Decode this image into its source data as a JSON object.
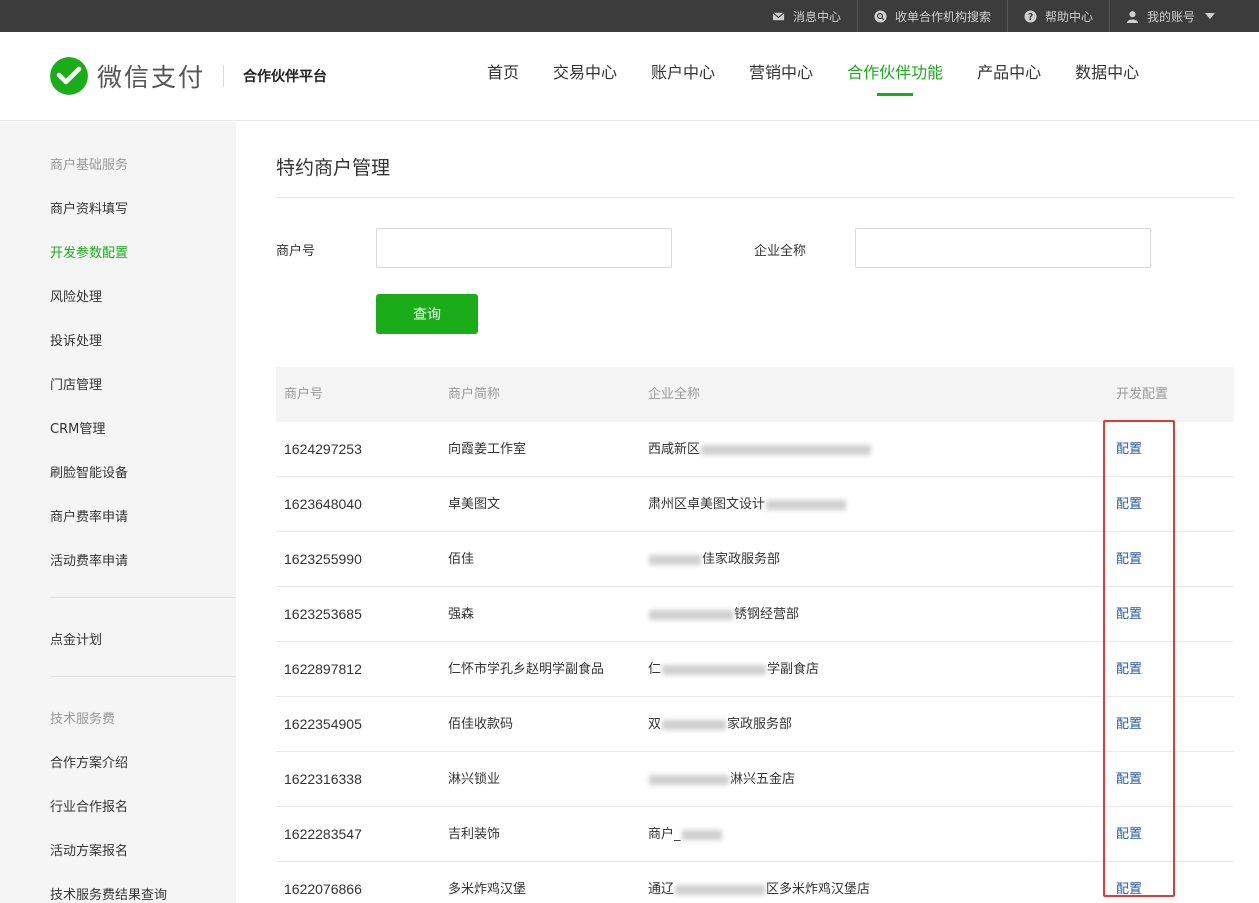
{
  "topbar": {
    "links": [
      {
        "icon": "mail-icon",
        "label": "消息中心"
      },
      {
        "icon": "search-circle-icon",
        "label": "收单合作机构搜索"
      },
      {
        "icon": "help-icon",
        "label": "帮助中心"
      },
      {
        "icon": "user-icon",
        "label": "我的账号"
      }
    ]
  },
  "header": {
    "logo_text": "微信支付",
    "platform": "合作伙伴平台",
    "nav": [
      "首页",
      "交易中心",
      "账户中心",
      "营销中心",
      "合作伙伴功能",
      "产品中心",
      "数据中心"
    ],
    "active_nav": "合作伙伴功能"
  },
  "sidebar": {
    "group1_title": "商户基础服务",
    "group1_items": [
      "商户资料填写",
      "开发参数配置",
      "风险处理",
      "投诉处理",
      "门店管理",
      "CRM管理",
      "刷脸智能设备",
      "商户费率申请",
      "活动费率申请"
    ],
    "active_item": "开发参数配置",
    "group2_items": [
      "点金计划"
    ],
    "group3_title": "技术服务费",
    "group3_items": [
      "合作方案介绍",
      "行业合作报名",
      "活动方案报名",
      "技术服务费结果查询"
    ]
  },
  "main": {
    "title": "特约商户管理",
    "form": {
      "merchant_no_label": "商户号",
      "merchant_no_value": "",
      "company_label": "企业全称",
      "company_value": "",
      "query_button": "查询"
    },
    "table": {
      "headers": [
        "商户号",
        "商户简称",
        "企业全称",
        "开发配置"
      ],
      "rows": [
        {
          "id": "1624297253",
          "short": "向霞姜工作室",
          "full_pre": "西咸新区",
          "full_post": "",
          "action": "配置"
        },
        {
          "id": "1623648040",
          "short": "卓美图文",
          "full_pre": "肃州区卓美图文设计",
          "full_post": "",
          "action": "配置"
        },
        {
          "id": "1623255990",
          "short": "佰佳",
          "full_pre": "",
          "full_post": "佳家政服务部",
          "action": "配置"
        },
        {
          "id": "1623253685",
          "short": "强森",
          "full_pre": "",
          "full_post": "锈钢经营部",
          "action": "配置"
        },
        {
          "id": "1622897812",
          "short": "仁怀市学孔乡赵明学副食品",
          "full_pre": "仁",
          "full_post": "学副食店",
          "action": "配置"
        },
        {
          "id": "1622354905",
          "short": "佰佳收款码",
          "full_pre": "双",
          "full_post": "家政服务部",
          "action": "配置"
        },
        {
          "id": "1622316338",
          "short": "淋兴锁业",
          "full_pre": "",
          "full_post": "淋兴五金店",
          "action": "配置"
        },
        {
          "id": "1622283547",
          "short": "吉利装饰",
          "full_pre": "商户_",
          "full_post": "",
          "action": "配置"
        },
        {
          "id": "1622076866",
          "short": "多米炸鸡汉堡",
          "full_pre": "通辽",
          "full_post": "区多米炸鸡汉堡店",
          "action": "配置"
        }
      ]
    }
  },
  "colors": {
    "brand_green": "#1aad19",
    "topbar_bg": "#3c3c3c",
    "link_blue": "#2a5caa",
    "highlight_red": "#e53935"
  }
}
